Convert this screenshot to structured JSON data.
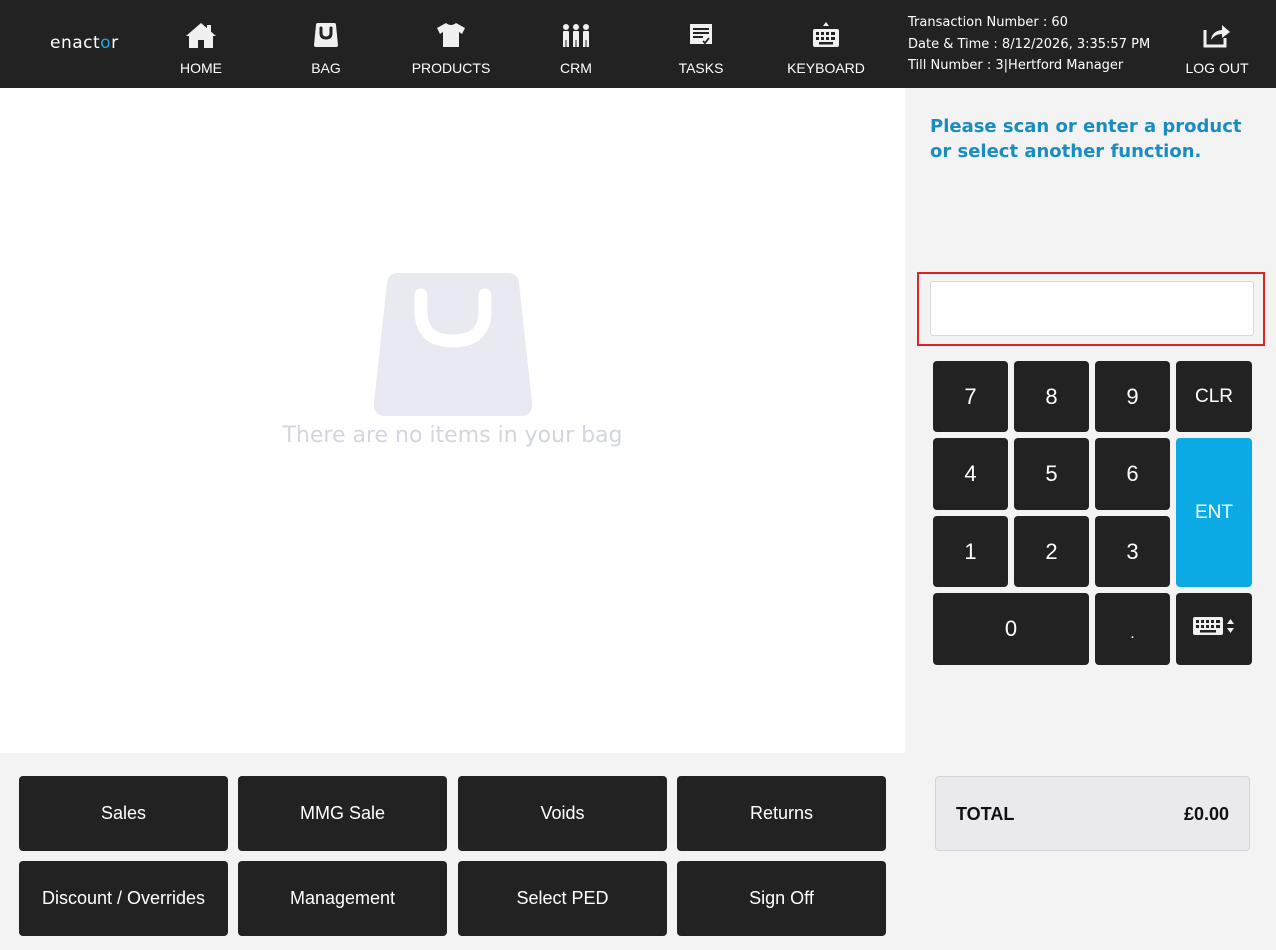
{
  "header": {
    "logo_text_a": "enact",
    "logo_text_b": "o",
    "logo_text_c": "r",
    "nav": [
      {
        "label": "HOME",
        "icon": "home-icon"
      },
      {
        "label": "BAG",
        "icon": "bag-icon"
      },
      {
        "label": "PRODUCTS",
        "icon": "tshirt-icon"
      },
      {
        "label": "CRM",
        "icon": "people-icon"
      },
      {
        "label": "TASKS",
        "icon": "tasks-icon"
      },
      {
        "label": "KEYBOARD",
        "icon": "keyboard-icon"
      }
    ],
    "transaction_number": "Transaction Number : 60",
    "date_time": "Date & Time : 8/12/2026, 3:35:57 PM",
    "till_number": "Till Number : 3",
    "separator": "|",
    "user": "Hertford Manager",
    "logout": {
      "label": "LOG OUT",
      "icon": "logout-icon"
    }
  },
  "bag": {
    "empty_icon": "shopping-bag-icon",
    "empty_text": "There are no items in your bag"
  },
  "right_panel": {
    "prompt": "Please scan or enter a product or select another function.",
    "input_value": "",
    "keypad": {
      "k7": "7",
      "k8": "8",
      "k9": "9",
      "clr": "CLR",
      "k4": "4",
      "k5": "5",
      "k6": "6",
      "ent": "ENT",
      "k1": "1",
      "k2": "2",
      "k3": "3",
      "k0": "0",
      "dot": ".",
      "keyboard_icon": "keyboard-toggle-icon"
    },
    "total": {
      "label": "TOTAL",
      "value": "£0.00"
    }
  },
  "functions": [
    "Sales",
    "MMG Sale",
    "Voids",
    "Returns",
    "Discount / Overrides",
    "Management",
    "Select PED",
    "Sign Off"
  ],
  "colors": {
    "topbar": "#222222",
    "accent_blue": "#0baae4",
    "prompt_blue": "#1a8dc0",
    "focus_red": "#e02424"
  }
}
